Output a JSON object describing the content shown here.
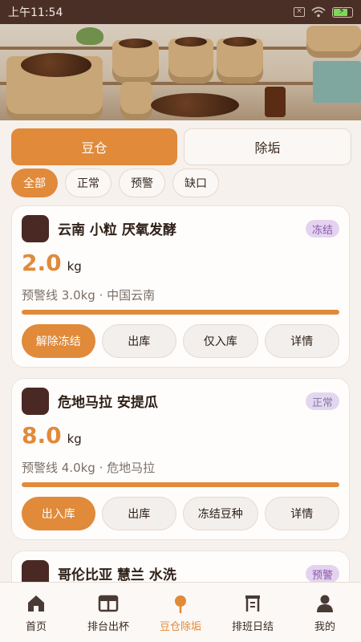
{
  "status_bar": {
    "time": "上午11:54",
    "icons": [
      "sim-icon",
      "wifi-icon",
      "battery-charging-icon"
    ]
  },
  "hero": {
    "image": "coffee-bean-storage-photo"
  },
  "segments": [
    {
      "label": "豆仓",
      "active": true
    },
    {
      "label": "除垢",
      "active": false
    }
  ],
  "filters": [
    {
      "label": "全部",
      "active": true
    },
    {
      "label": "正常",
      "active": false
    },
    {
      "label": "预警",
      "active": false
    },
    {
      "label": "缺口",
      "active": false
    }
  ],
  "cards": [
    {
      "name": "云南 小粒 厌氧发酵",
      "badge": "冻结",
      "badge_bg": "#e4d3f0",
      "badge_color": "#8a5aa8",
      "quantity": "2.0",
      "unit": "kg",
      "meta": "预警线 3.0kg · 中国云南",
      "level": 1.0,
      "actions": [
        {
          "label": "解除冻结",
          "primary": true
        },
        {
          "label": "出库",
          "primary": false
        },
        {
          "label": "仅入库",
          "primary": false
        },
        {
          "label": "详情",
          "primary": false
        }
      ]
    },
    {
      "name": "危地马拉 安提瓜",
      "badge": "正常",
      "badge_bg": "#e2d7ef",
      "badge_color": "#8a7aa8",
      "quantity": "8.0",
      "unit": "kg",
      "meta": "预警线 4.0kg · 危地马拉",
      "level": 1.0,
      "actions": [
        {
          "label": "出入库",
          "primary": true
        },
        {
          "label": "出库",
          "primary": false
        },
        {
          "label": "冻结豆种",
          "primary": false
        },
        {
          "label": "详情",
          "primary": false
        }
      ]
    },
    {
      "name": "哥伦比亚 慧兰 水洗",
      "badge": "预警",
      "badge_bg": "#e4d3f0",
      "badge_color": "#8a5aa8"
    }
  ],
  "tabs": [
    {
      "label": "首页",
      "icon": "home-icon",
      "active": false
    },
    {
      "label": "排台出杯",
      "icon": "counter-icon",
      "active": false
    },
    {
      "label": "豆仓除垢",
      "icon": "pin-icon",
      "active": true
    },
    {
      "label": "排班日结",
      "icon": "schedule-icon",
      "active": false
    },
    {
      "label": "我的",
      "icon": "user-icon",
      "active": false
    }
  ],
  "colors": {
    "accent": "#e08a3a",
    "status_bar": "#4a2f27",
    "bean_dot": "#4a2924"
  }
}
